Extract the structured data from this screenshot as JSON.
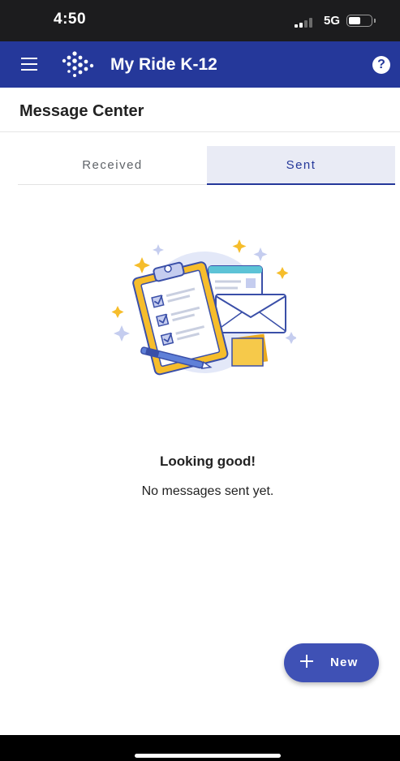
{
  "status_bar": {
    "time": "4:50",
    "network": "5G"
  },
  "app_bar": {
    "title": "My Ride K-12",
    "help_glyph": "?",
    "icons": [
      "menu-icon",
      "app-logo-icon",
      "help-icon"
    ],
    "color": "#25389a"
  },
  "page": {
    "title": "Message Center"
  },
  "tabs": [
    {
      "label": "Received",
      "selected": false
    },
    {
      "label": "Sent",
      "selected": true
    }
  ],
  "empty_state": {
    "title": "Looking good!",
    "message": "No messages sent yet.",
    "illustration": "clipboard-envelope-illustration"
  },
  "fab": {
    "label": "New",
    "icon": "plus-icon",
    "color": "#3f51b5"
  },
  "colors": {
    "primary": "#25389a",
    "tab_selected_bg": "#e9ebf5",
    "accent_yellow": "#f6bd2b"
  }
}
